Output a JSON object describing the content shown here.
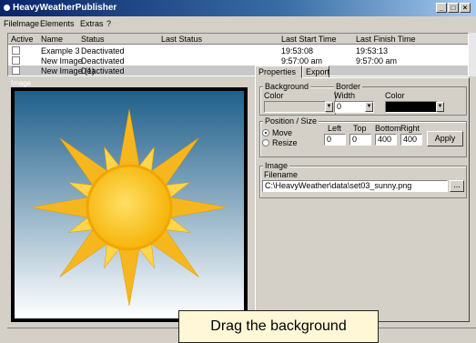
{
  "window": {
    "title": "HeavyWeatherPublisher",
    "minimize": "_",
    "maximize": "□",
    "close": "×"
  },
  "menu": [
    "File",
    "Image",
    "Elements",
    "Extras",
    "?"
  ],
  "list": {
    "columns": [
      "Active",
      "Name",
      "Status",
      "Last Status",
      "Last Start Time",
      "Last Finish Time"
    ],
    "rows": [
      {
        "name": "Example 3",
        "status": "Deactivated",
        "last_status": "",
        "start": "19:53:08",
        "finish": "19:53:13"
      },
      {
        "name": "New Image",
        "status": "Deactivated",
        "last_status": "",
        "start": "9:57:00 am",
        "finish": "9:57:00 am"
      },
      {
        "name": "New Image (1)",
        "status": "Deactivated",
        "last_status": "",
        "start": "",
        "finish": ""
      }
    ]
  },
  "image_section_label": "Image",
  "tabs": {
    "properties": "Properties",
    "export": "Export"
  },
  "properties": {
    "background_group": "Background",
    "color_label": "Color",
    "border_group": "Border",
    "width_label": "Width",
    "border_color_label": "Color",
    "border_width": "0",
    "position_group": "Position / Size",
    "move": "Move",
    "resize": "Resize",
    "left_label": "Left",
    "top_label": "Top",
    "bottom_label": "Bottom",
    "right_label": "Right",
    "left": "0",
    "top": "0",
    "bottom": "400",
    "right": "400",
    "apply": "Apply",
    "image_group": "Image",
    "filename_label": "Filename",
    "filename": "C:\\HeavyWeather\\data\\set03_sunny.png",
    "browse": "..."
  },
  "callout": "Drag the background",
  "colors": {
    "border_color": "#000000",
    "sky_top": "#1f5f8a",
    "sky_bottom": "#ffffff",
    "sun": "#ffc828"
  }
}
